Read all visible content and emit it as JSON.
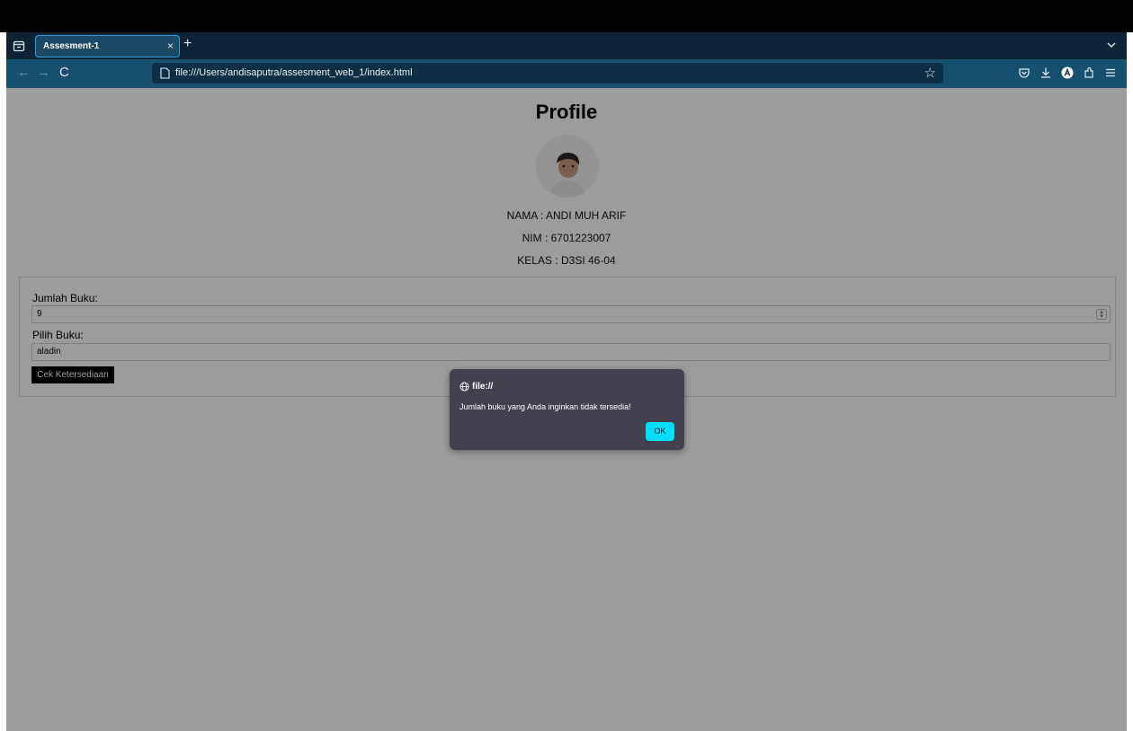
{
  "browser": {
    "tab_title": "Assesment-1",
    "tab_close": "×",
    "new_tab": "+",
    "nav_back": "←",
    "nav_forward": "→",
    "nav_reload": "C",
    "url": "file:///Users/andisaputra/assesment_web_1/index.html",
    "bookmark_star": "☆",
    "icons": [
      "sidebar-icon",
      "pocket-icon",
      "download-icon",
      "account-icon",
      "extensions-icon",
      "menu-icon",
      "tab-list-icon"
    ]
  },
  "page": {
    "title": "Profile",
    "nama": "NAMA : ANDI MUH ARIF",
    "nim": "NIM : 6701223007",
    "kelas": "KELAS : D3SI 46-04"
  },
  "form": {
    "jumlah_label": "Jumlah Buku:",
    "jumlah_value": "9",
    "pilih_label": "Pilih Buku:",
    "pilih_value": "aladin",
    "check_button": "Cek Ketersediaan"
  },
  "dialog": {
    "origin": "file://",
    "message": "Jumlah buku yang Anda inginkan tidak tersedia!",
    "ok_label": "OK"
  },
  "colors": {
    "accent": "#00ddff",
    "dialog_bg": "#42414d",
    "toolbar_bg": "#17506e"
  }
}
